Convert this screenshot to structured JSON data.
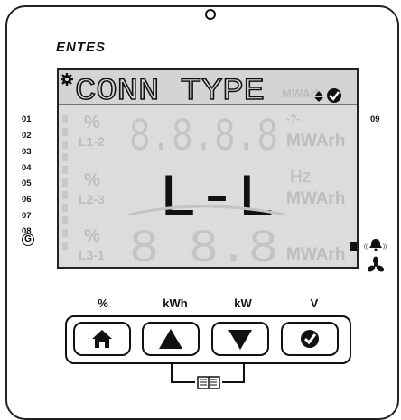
{
  "brand": "ENTES",
  "display": {
    "top_text": "CONN TYPE",
    "main_text": "L-L",
    "ghost_digits": "8.8.8.8",
    "ghost_mid_digits": "8 8.8",
    "unit_top": "MWArh",
    "unit_mid": "MWArh",
    "unit_bottom": "MWArh",
    "hz": "Hz",
    "percent": "%",
    "phase_1": "L1-2",
    "phase_2": "L2-3",
    "phase_3": "L3-1",
    "question": "-?-"
  },
  "channels": [
    "01",
    "02",
    "03",
    "04",
    "05",
    "06",
    "07",
    "08"
  ],
  "channel_right": "09",
  "g_label": "G",
  "buttons": [
    {
      "label": "%",
      "icon": "home-icon"
    },
    {
      "label": "kWh",
      "icon": "up-triangle-icon"
    },
    {
      "label": "kW",
      "icon": "down-triangle-icon"
    },
    {
      "label": "V",
      "icon": "check-circle-icon"
    }
  ],
  "colors": {
    "lcd_bg": "#dcdcdc",
    "ghost": "#bdbdbd",
    "ink": "#111111"
  }
}
